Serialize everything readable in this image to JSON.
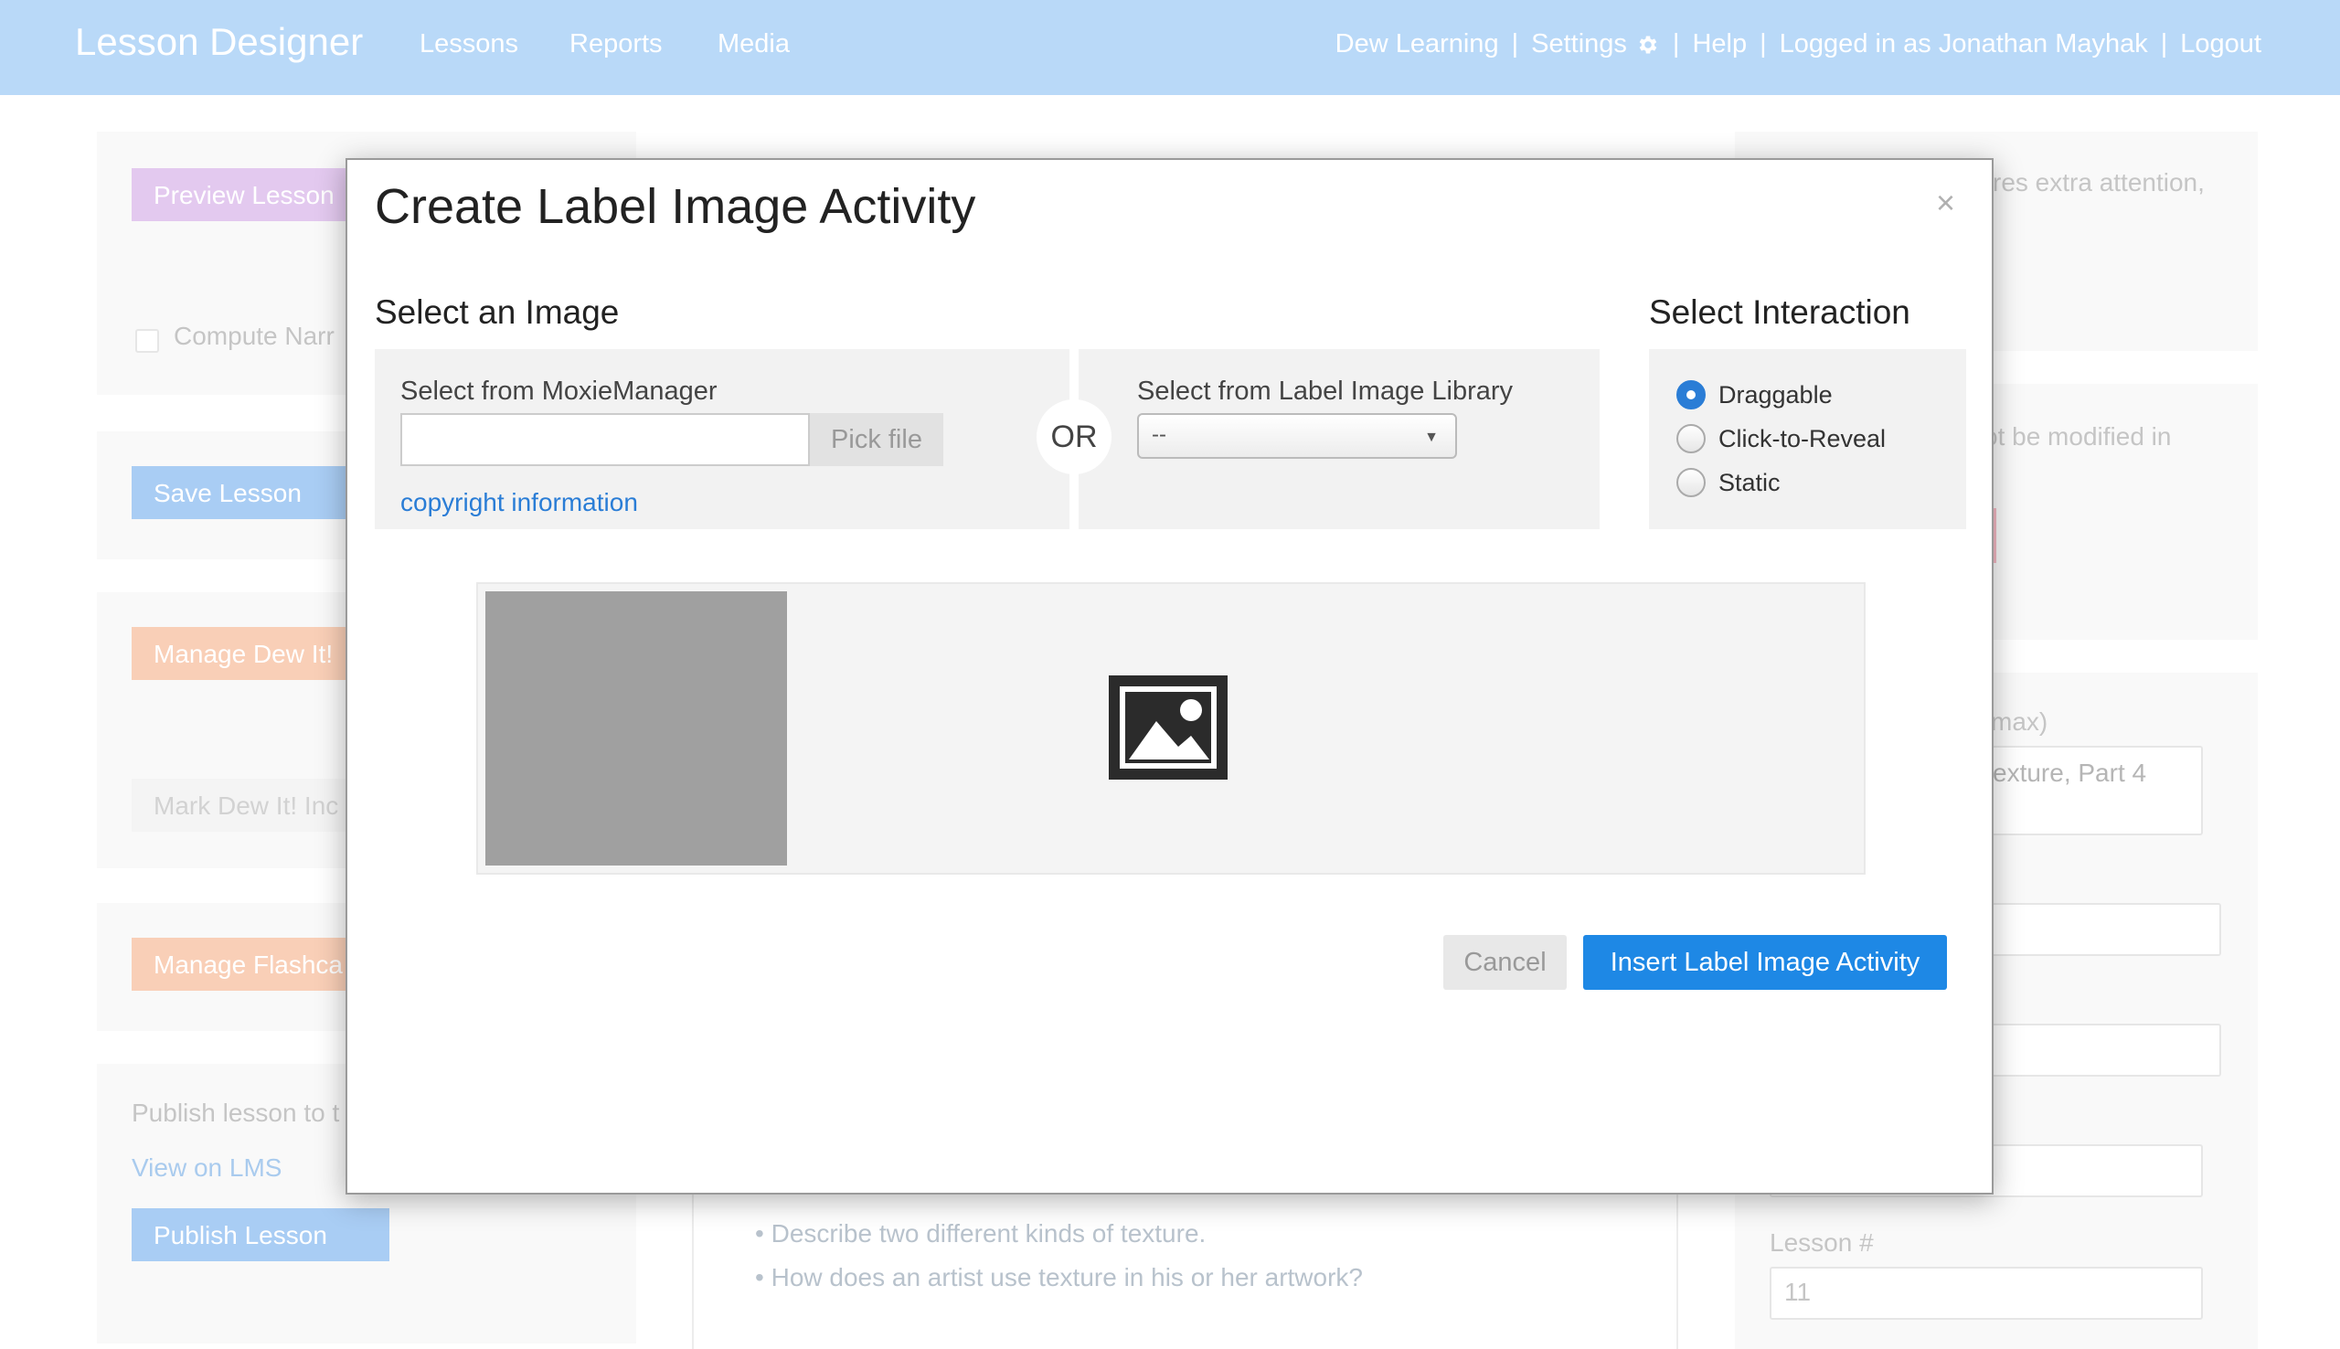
{
  "header": {
    "brand": "Lesson Designer",
    "nav": [
      "Lessons",
      "Reports",
      "Media"
    ],
    "right": {
      "org": "Dew Learning",
      "settings": "Settings",
      "help": "Help",
      "user": "Logged in as Jonathan Mayhak",
      "logout": "Logout",
      "separator": "|"
    }
  },
  "background": {
    "left": {
      "preview_label": "Preview Lesson",
      "compute_label": "Compute Narr",
      "save_label": "Save Lesson",
      "manage_dew_label": "Manage Dew It!",
      "mark_dew_label": "Mark Dew It! Inc",
      "manage_flash_label": "Manage Flashca",
      "publish_text": "Publish lesson to t",
      "view_lms_label": "View on LMS",
      "publish_label": "Publish Lesson"
    },
    "center": {
      "bullets": [
        "Describe two different kinds of texture.",
        "How does an artist use texture in his or her artwork?"
      ]
    },
    "right": {
      "note_text": "res extra attention,",
      "modified_text": "ot be modified in",
      "max_label": "max)",
      "title_value": "exture, Part 4",
      "lesson_num_label": "Lesson #",
      "lesson_num_value": "11"
    }
  },
  "modal": {
    "title": "Create Label Image Activity",
    "close": "×",
    "select_image_heading": "Select an Image",
    "moxie_label": "Select from MoxieManager",
    "moxie_value": "",
    "pick_file": "Pick file",
    "copyright_link": "copyright information",
    "or": "OR",
    "library_label": "Select from Label Image Library",
    "library_selected": "--",
    "interaction_heading": "Select Interaction",
    "interactions": [
      {
        "label": "Draggable",
        "checked": true
      },
      {
        "label": "Click-to-Reveal",
        "checked": false
      },
      {
        "label": "Static",
        "checked": false
      }
    ],
    "cancel": "Cancel",
    "insert": "Insert Label Image Activity"
  },
  "colors": {
    "nav_bg": "#b9d9f8",
    "primary": "#1e88e5",
    "link": "#2a7dd6"
  }
}
